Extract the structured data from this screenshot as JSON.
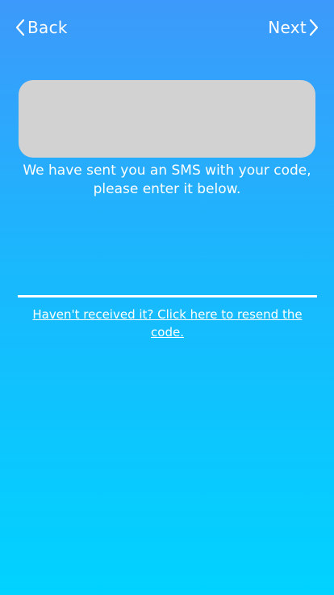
{
  "nav": {
    "back_label": "Back",
    "next_label": "Next"
  },
  "instruction": {
    "line1": "We have sent you an SMS with your code,",
    "line2": "please enter it below."
  },
  "code_input": {
    "value": "",
    "placeholder": ""
  },
  "resend": {
    "label": "Haven't received it? Click here to resend the code."
  },
  "colors": {
    "gradient_top": "#3d99fb",
    "gradient_bottom": "#00d3ff",
    "placeholder_box": "#d2d2d2",
    "text": "#ffffff"
  },
  "icons": {
    "back": "chevron-left-icon",
    "next": "chevron-right-icon"
  }
}
